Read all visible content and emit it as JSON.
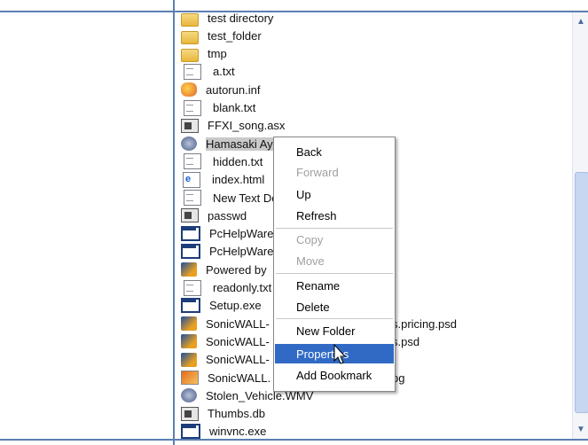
{
  "files": [
    {
      "name": "test directory",
      "icon": "folder-icon",
      "kind": "folder"
    },
    {
      "name": "test_folder",
      "icon": "folder-icon",
      "kind": "folder"
    },
    {
      "name": "tmp",
      "icon": "folder-icon",
      "kind": "folder"
    },
    {
      "name": "a.txt",
      "icon": "text-file-icon",
      "kind": "doc"
    },
    {
      "name": "autorun.inf",
      "icon": "settings-file-icon",
      "kind": "gear"
    },
    {
      "name": "blank.txt",
      "icon": "text-file-icon",
      "kind": "doc"
    },
    {
      "name": "FFXI_song.asx",
      "icon": "media-list-icon",
      "kind": "sys"
    },
    {
      "name": "Hamasaki Ay",
      "icon": "media-file-icon",
      "kind": "media",
      "selected": true
    },
    {
      "name": "hidden.txt",
      "icon": "text-file-icon",
      "kind": "doc"
    },
    {
      "name": "index.html",
      "icon": "html-file-icon",
      "kind": "html"
    },
    {
      "name": "New Text Do",
      "icon": "text-file-icon",
      "kind": "doc"
    },
    {
      "name": "passwd",
      "icon": "system-file-icon",
      "kind": "sys"
    },
    {
      "name": "PcHelpWare",
      "icon": "application-icon",
      "kind": "win"
    },
    {
      "name": "PcHelpWare",
      "icon": "application-icon",
      "kind": "win"
    },
    {
      "name": "Powered by",
      "icon": "image-file-icon",
      "kind": "ps"
    },
    {
      "name": "readonly.txt",
      "icon": "text-file-icon",
      "kind": "doc"
    },
    {
      "name": "Setup.exe",
      "icon": "application-icon",
      "kind": "win"
    },
    {
      "name": "SonicWALL-",
      "suffix": "s.pricing.psd",
      "icon": "photoshop-file-icon",
      "kind": "ps"
    },
    {
      "name": "SonicWALL-",
      "suffix": "s.psd",
      "icon": "photoshop-file-icon",
      "kind": "ps"
    },
    {
      "name": "SonicWALL-",
      "icon": "photoshop-file-icon",
      "kind": "ps"
    },
    {
      "name": "SonicWALL.",
      "suffix": "pg",
      "icon": "image-file-icon",
      "kind": "img"
    },
    {
      "name": "Stolen_Vehicle.WMV",
      "icon": "media-file-icon",
      "kind": "media"
    },
    {
      "name": "Thumbs.db",
      "icon": "system-file-icon",
      "kind": "sys"
    },
    {
      "name": "winvnc.exe",
      "icon": "application-icon",
      "kind": "win"
    }
  ],
  "context_menu": {
    "items": [
      {
        "label": "Back",
        "enabled": true
      },
      {
        "label": "Forward",
        "enabled": false
      },
      {
        "label": "Up",
        "enabled": true
      },
      {
        "label": "Refresh",
        "enabled": true
      },
      {
        "label": "Copy",
        "enabled": false
      },
      {
        "label": "Move",
        "enabled": false
      },
      {
        "label": "Rename",
        "enabled": true
      },
      {
        "label": "Delete",
        "enabled": true
      },
      {
        "label": "New Folder",
        "enabled": true
      },
      {
        "label": "Properties",
        "enabled": true,
        "highlighted": true
      },
      {
        "label": "Add Bookmark",
        "enabled": true
      }
    ]
  },
  "colors": {
    "highlight": "#316ac5",
    "frame": "#5b7fb3"
  }
}
